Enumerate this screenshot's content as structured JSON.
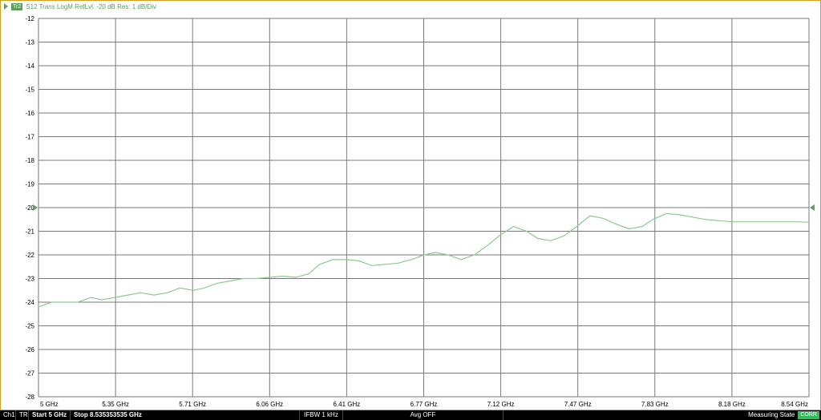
{
  "header": {
    "trace_badge": "Tr2",
    "trace_label": "S12 Trans LogM RefLvl: -20  dB Res: 1  dB/Div"
  },
  "colors": {
    "trace": "#8fc98f",
    "grid": "#7a7a7a",
    "accent": "#5aa05a",
    "frame": "#d4a020",
    "status_badge": "#2fbf5a"
  },
  "status_bar": {
    "channel": "Ch1",
    "mode": "TR",
    "start": "Start 5 GHz",
    "stop": "Stop 8.535353535 GHz",
    "ifbw": "IFBW 1 kHz",
    "avg": "Avg OFF",
    "state": "Measuring State",
    "badge": "CORR"
  },
  "chart_data": {
    "type": "line",
    "title": "S12 Trans LogM RefLvl: -20  dB Res: 1  dB/Div",
    "xlabel": "",
    "ylabel": "",
    "xlim": [
      5.0,
      8.5354
    ],
    "ylim": [
      -28,
      -12
    ],
    "grid": true,
    "reference_level": -20,
    "x_ticks": [
      "5 GHz",
      "5.35 GHz",
      "5.71 GHz",
      "6.06 GHz",
      "6.41 GHz",
      "6.77 GHz",
      "7.12 GHz",
      "7.47 GHz",
      "7.83 GHz",
      "8.18 GHz",
      "8.54 GHz"
    ],
    "y_ticks": [
      "-12",
      "-13",
      "-14",
      "-15",
      "-16",
      "-17",
      "-18",
      "-19",
      "-20",
      "-21",
      "-22",
      "-23",
      "-24",
      "-25",
      "-26",
      "-27",
      "-28"
    ],
    "series": [
      {
        "x": [
          5.0,
          5.06,
          5.12,
          5.18,
          5.24,
          5.29,
          5.35,
          5.41,
          5.47,
          5.53,
          5.59,
          5.65,
          5.71,
          5.76,
          5.82,
          5.88,
          5.94,
          6.0,
          6.06,
          6.12,
          6.18,
          6.24,
          6.29,
          6.35,
          6.41,
          6.47,
          6.53,
          6.59,
          6.65,
          6.71,
          6.77,
          6.82,
          6.88,
          6.94,
          7.0,
          7.06,
          7.12,
          7.18,
          7.24,
          7.29,
          7.35,
          7.41,
          7.47,
          7.53,
          7.59,
          7.65,
          7.71,
          7.77,
          7.82,
          7.88,
          7.94,
          8.0,
          8.06,
          8.12,
          8.18,
          8.24,
          8.3,
          8.35,
          8.41,
          8.47,
          8.535
        ],
        "y": [
          -24.2,
          -24.0,
          -24.0,
          -24.0,
          -23.8,
          -23.9,
          -23.8,
          -23.7,
          -23.6,
          -23.7,
          -23.6,
          -23.4,
          -23.5,
          -23.4,
          -23.2,
          -23.1,
          -23.0,
          -23.0,
          -22.95,
          -22.9,
          -22.95,
          -22.8,
          -22.4,
          -22.2,
          -22.2,
          -22.25,
          -22.45,
          -22.4,
          -22.35,
          -22.2,
          -22.0,
          -21.9,
          -22.0,
          -22.2,
          -22.0,
          -21.6,
          -21.15,
          -20.8,
          -21.0,
          -21.3,
          -21.4,
          -21.2,
          -20.8,
          -20.35,
          -20.45,
          -20.7,
          -20.9,
          -20.8,
          -20.5,
          -20.25,
          -20.3,
          -20.4,
          -20.5,
          -20.55,
          -20.6,
          -20.6,
          -20.6,
          -20.6,
          -20.6,
          -20.6,
          -20.62
        ]
      }
    ]
  }
}
